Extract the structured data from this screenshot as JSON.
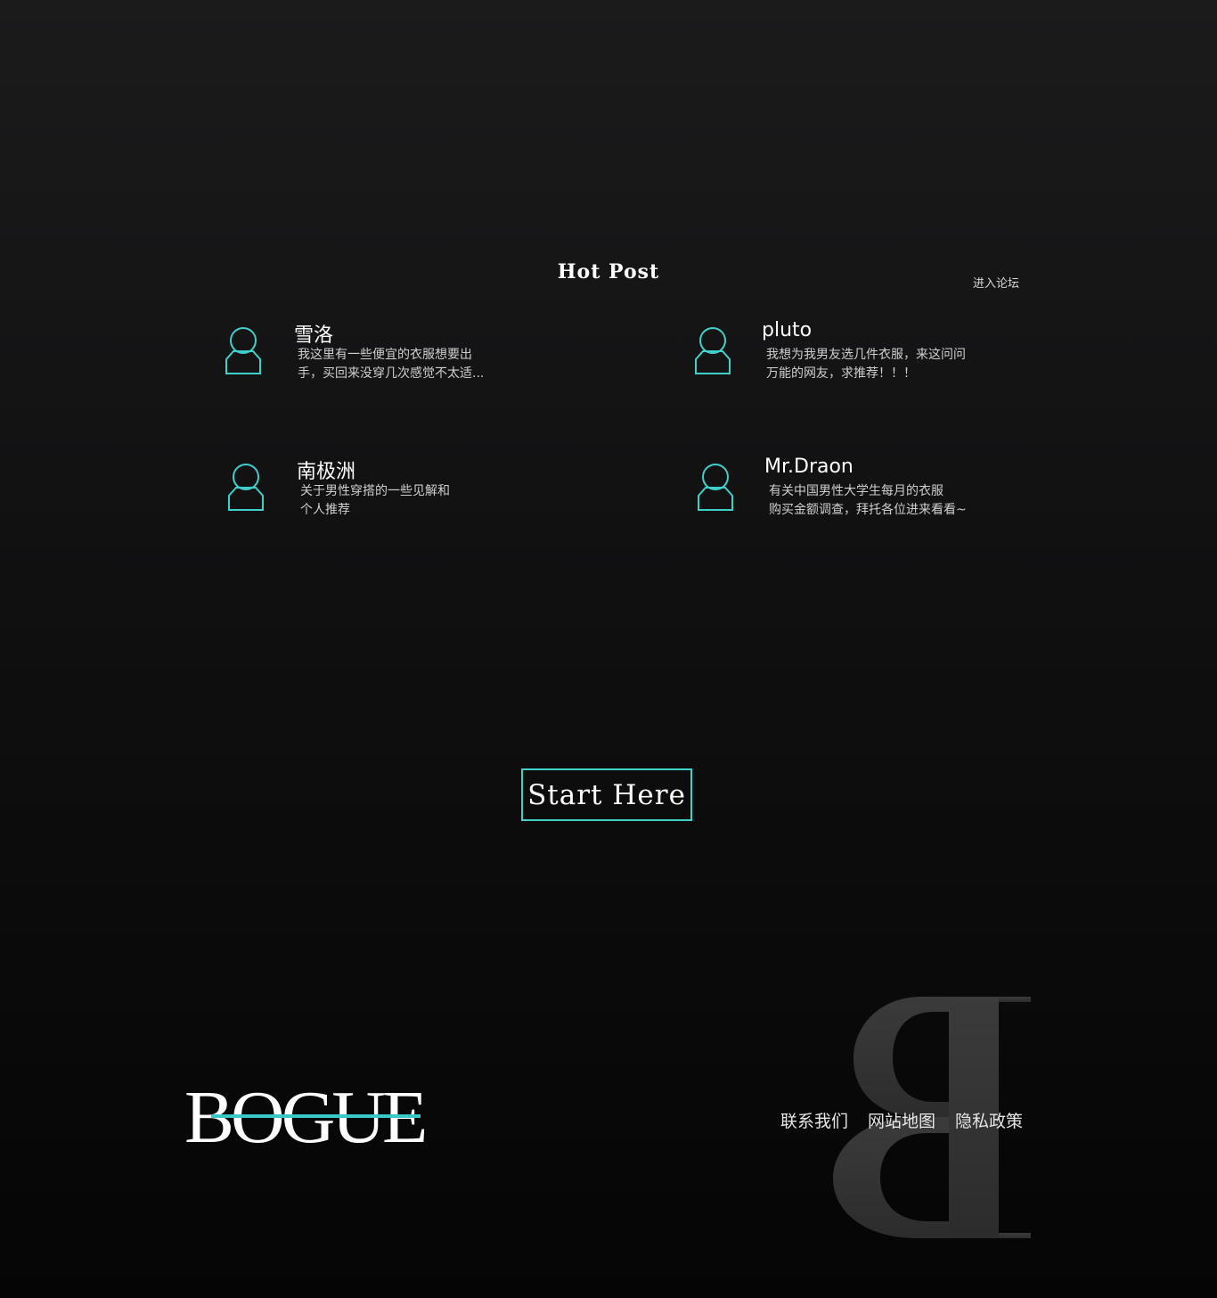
{
  "hot_post": {
    "title": "Hot Post",
    "forum_link": "进入论坛",
    "posts": [
      {
        "author": "雪洛",
        "excerpt": [
          "我这里有一些便宜的衣服想要出",
          "手，买回来没穿几次感觉不太适..."
        ],
        "avatar_icon": "user-icon"
      },
      {
        "author": "pluto",
        "excerpt": [
          "我想为我男友选几件衣服，来这问问",
          "万能的网友，求推荐！！！"
        ],
        "avatar_icon": "user-icon"
      },
      {
        "author": "南极洲",
        "excerpt": [
          "关于男性穿搭的一些见解和",
          "个人推荐"
        ],
        "avatar_icon": "user-icon"
      },
      {
        "author": "Mr.Draon",
        "excerpt": [
          "有关中国男性大学生每月的衣服",
          "购买金额调查，拜托各位进来看看~"
        ],
        "avatar_icon": "user-icon"
      }
    ]
  },
  "cta": {
    "label": "Start Here"
  },
  "footer": {
    "logo_text": "BOGUE",
    "links": [
      "联系我们",
      "网站地图",
      "隐私政策"
    ]
  },
  "colors": {
    "accent": "#3fd0cc",
    "background_top": "#1b1b1c",
    "background_bottom": "#050505",
    "text": "#ffffff",
    "muted_text": "#cfcfcf",
    "watermark": "#3a3a3a"
  }
}
